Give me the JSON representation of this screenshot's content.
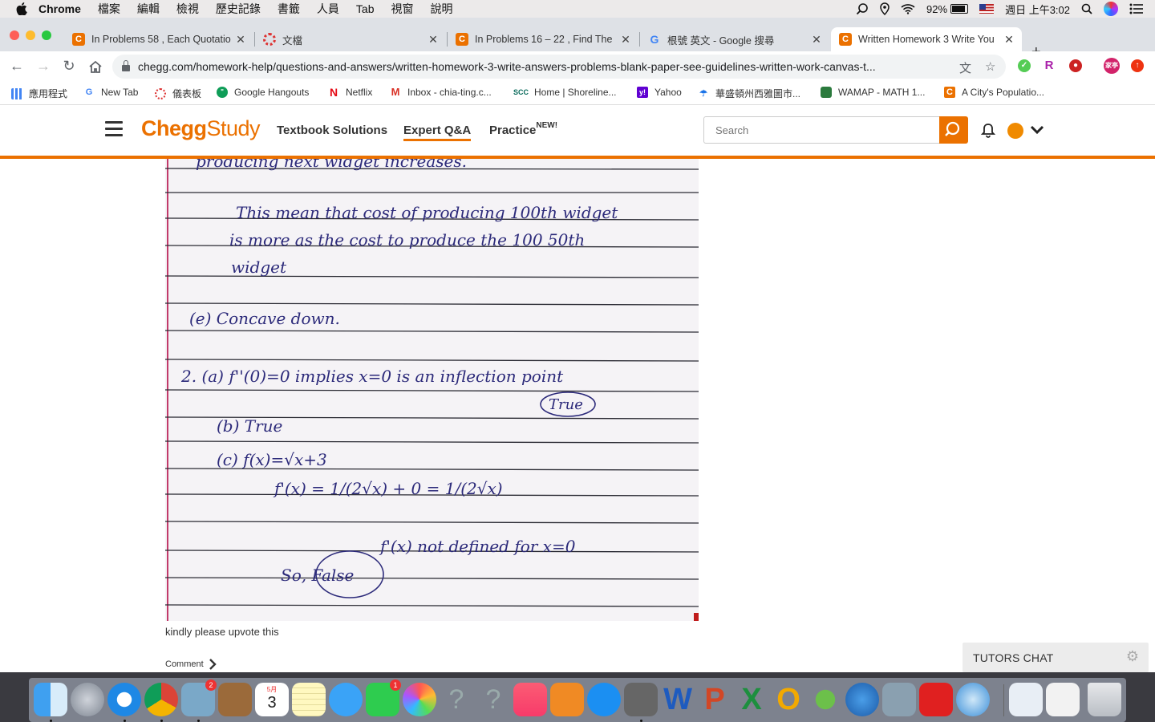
{
  "menubar": {
    "app": "Chrome",
    "menus": [
      "檔案",
      "編輯",
      "檢視",
      "歷史記錄",
      "書籤",
      "人員",
      "Tab",
      "視窗",
      "說明"
    ],
    "battery": "92%",
    "datetime": "週日 上午3:02"
  },
  "tabs": [
    {
      "title": "In Problems 58 , Each Quotatio",
      "icon": "chegg-icon",
      "active": false
    },
    {
      "title": "文檔",
      "icon": "dots-loader-icon",
      "active": false
    },
    {
      "title": "In Problems 16 – 22 , Find The",
      "icon": "chegg-icon",
      "active": false
    },
    {
      "title": "根號 英文 - Google 搜尋",
      "icon": "google-icon",
      "active": false
    },
    {
      "title": "Written Homework 3 Write You",
      "icon": "chegg-icon",
      "active": true
    }
  ],
  "toolbar": {
    "url": "chegg.com/homework-help/questions-and-answers/written-homework-3-write-answers-problems-blank-paper-see-guidelines-written-work-canvas-t..."
  },
  "bookmarks": [
    {
      "label": "應用程式",
      "icon": "apps-grid-icon"
    },
    {
      "label": "New Tab",
      "icon": "google-icon"
    },
    {
      "label": "儀表板",
      "icon": "dots-loader-icon"
    },
    {
      "label": "Google Hangouts",
      "icon": "hangouts-icon"
    },
    {
      "label": "Netflix",
      "icon": "netflix-icon"
    },
    {
      "label": "Inbox - chia-ting.c...",
      "icon": "gmail-icon"
    },
    {
      "label": "Home | Shoreline...",
      "icon": "scc-icon"
    },
    {
      "label": "Yahoo",
      "icon": "yahoo-icon"
    },
    {
      "label": "華盛頓州西雅圖市...",
      "icon": "weather-icon"
    },
    {
      "label": "WAMAP - MATH 1...",
      "icon": "wamap-icon"
    },
    {
      "label": "A City's Populatio...",
      "icon": "chegg-icon"
    }
  ],
  "chegg": {
    "logo_main": "Chegg",
    "logo_sub": "Study",
    "nav": [
      "Textbook Solutions",
      "Expert Q&A",
      "Practice"
    ],
    "new_badge": "NEW!",
    "search_placeholder": "Search",
    "brand_color": "#eb7100"
  },
  "answer": {
    "handwriting": [
      "producing next widget increases.",
      "This mean that cost of producing 100th widget",
      "is more as the cost to produce the 100 50th",
      "widget",
      "(e) Concave down.",
      "2. (a) f''(0)=0 implies x=0 is an inflection point",
      "True",
      "(b) True",
      "(c) f(x)=√x+3",
      "f'(x) = 1/(2√x) + 0 = 1/(2√x)",
      "f'(x) not defined for x=0",
      "So, False"
    ],
    "text": "kindly please upvote this",
    "comment": "Comment"
  },
  "tutors_chat": "TUTORS CHAT",
  "dock": {
    "badges": [
      "2",
      "1"
    ],
    "calendar_month": "5月",
    "calendar_day": "3"
  }
}
